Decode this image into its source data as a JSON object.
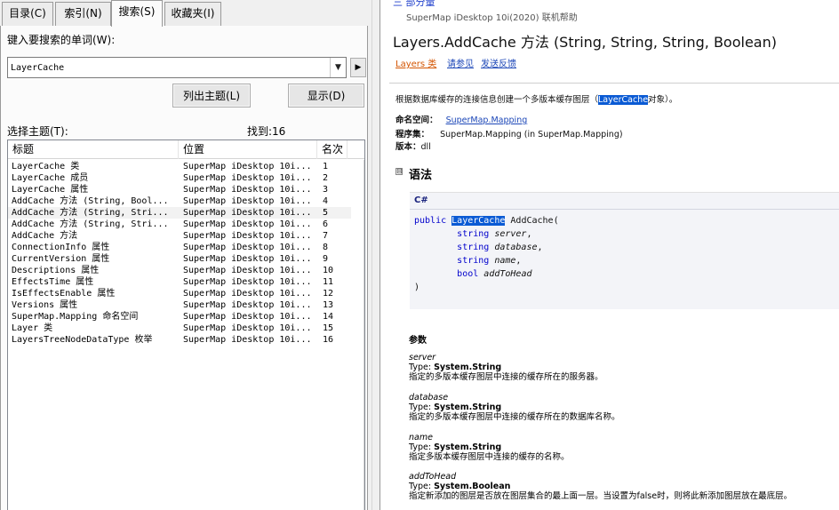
{
  "tabs": [
    {
      "label": "目录(C)"
    },
    {
      "label": "索引(N)"
    },
    {
      "label": "搜索(S)"
    },
    {
      "label": "收藏夹(I)"
    }
  ],
  "search": {
    "keyword_label": "键入要搜索的单词(W):",
    "keyword_value": "LayerCache",
    "list_topics_label": "列出主题(L)",
    "display_label": "显示(D)",
    "topic_label": "选择主题(T):",
    "found_label": "找到:16"
  },
  "results": {
    "columns": [
      "标题",
      "位置",
      "名次"
    ],
    "selected_index": 4,
    "rows": [
      {
        "title": "LayerCache 类",
        "location": "SuperMap iDesktop 10i...",
        "rank": "1"
      },
      {
        "title": "LayerCache 成员",
        "location": "SuperMap iDesktop 10i...",
        "rank": "2"
      },
      {
        "title": "LayerCache 属性",
        "location": "SuperMap iDesktop 10i...",
        "rank": "3"
      },
      {
        "title": "AddCache 方法 (String, Bool...",
        "location": "SuperMap iDesktop 10i...",
        "rank": "4"
      },
      {
        "title": "AddCache 方法 (String, Stri...",
        "location": "SuperMap iDesktop 10i...",
        "rank": "5"
      },
      {
        "title": "AddCache 方法 (String, Stri...",
        "location": "SuperMap iDesktop 10i...",
        "rank": "6"
      },
      {
        "title": "AddCache 方法",
        "location": "SuperMap iDesktop 10i...",
        "rank": "7"
      },
      {
        "title": "ConnectionInfo 属性",
        "location": "SuperMap iDesktop 10i...",
        "rank": "8"
      },
      {
        "title": "CurrentVersion 属性",
        "location": "SuperMap iDesktop 10i...",
        "rank": "9"
      },
      {
        "title": "Descriptions 属性",
        "location": "SuperMap iDesktop 10i...",
        "rank": "10"
      },
      {
        "title": "EffectsTime 属性",
        "location": "SuperMap iDesktop 10i...",
        "rank": "11"
      },
      {
        "title": "IsEffectsEnable 属性",
        "location": "SuperMap iDesktop 10i...",
        "rank": "12"
      },
      {
        "title": "Versions 属性",
        "location": "SuperMap iDesktop 10i...",
        "rank": "13"
      },
      {
        "title": "SuperMap.Mapping 命名空间",
        "location": "SuperMap iDesktop 10i...",
        "rank": "14"
      },
      {
        "title": "Layer 类",
        "location": "SuperMap iDesktop 10i...",
        "rank": "15"
      },
      {
        "title": "LayersTreeNodeDataType 枚举",
        "location": "SuperMap iDesktop 10i...",
        "rank": "16"
      }
    ]
  },
  "doc": {
    "toc_peek": "三 部分量",
    "subtitle": "SuperMap iDesktop 10i(2020) 联机帮助",
    "title": "Layers.AddCache 方法  (String, String, String, Boolean)",
    "links": {
      "class": "Layers 类",
      "see_also": "请参见",
      "feedback": "发送反馈"
    },
    "summary_before": "根据数据库缓存的连接信息创建一个多版本缓存图层（",
    "summary_highlight": "LayerCache",
    "summary_after": "对象）。",
    "namespace_label": "命名空间：",
    "namespace_value": "SuperMap.Mapping",
    "assembly_label": "程序集：",
    "assembly_value": "SuperMap.Mapping (in SuperMap.Mapping)",
    "version_label": "版本：",
    "version_value": "dll",
    "syntax_toggle": "⊟",
    "syntax_heading": "语法",
    "code_lang": "C#",
    "code": {
      "kw_public": "public",
      "ret_type": "LayerCache",
      "method": "AddCache(",
      "params": [
        {
          "type": "string",
          "name": "server",
          "sep": ","
        },
        {
          "type": "string",
          "name": "database",
          "sep": ","
        },
        {
          "type": "string",
          "name": "name",
          "sep": ","
        },
        {
          "type": "bool",
          "name": "addToHead",
          "sep": ""
        }
      ],
      "close": ")"
    },
    "params_heading": "参数",
    "params": [
      {
        "name": "server",
        "type_label": "Type:",
        "type": "System.String",
        "desc": "指定的多版本缓存图层中连接的缓存所在的服务器。"
      },
      {
        "name": "database",
        "type_label": "Type:",
        "type": "System.String",
        "desc": "指定的多版本缓存图层中连接的缓存所在的数据库名称。"
      },
      {
        "name": "name",
        "type_label": "Type:",
        "type": "System.String",
        "desc": "指定多版本缓存图层中连接的缓存的名称。"
      },
      {
        "name": "addToHead",
        "type_label": "Type:",
        "type": "System.Boolean",
        "desc": "指定新添加的图层是否放在图层集合的最上面一层。当设置为false时，则将此新添加图层放在最底层。"
      }
    ]
  },
  "icons": {
    "combo_arrow": "▼",
    "go_arrow": "▶"
  }
}
